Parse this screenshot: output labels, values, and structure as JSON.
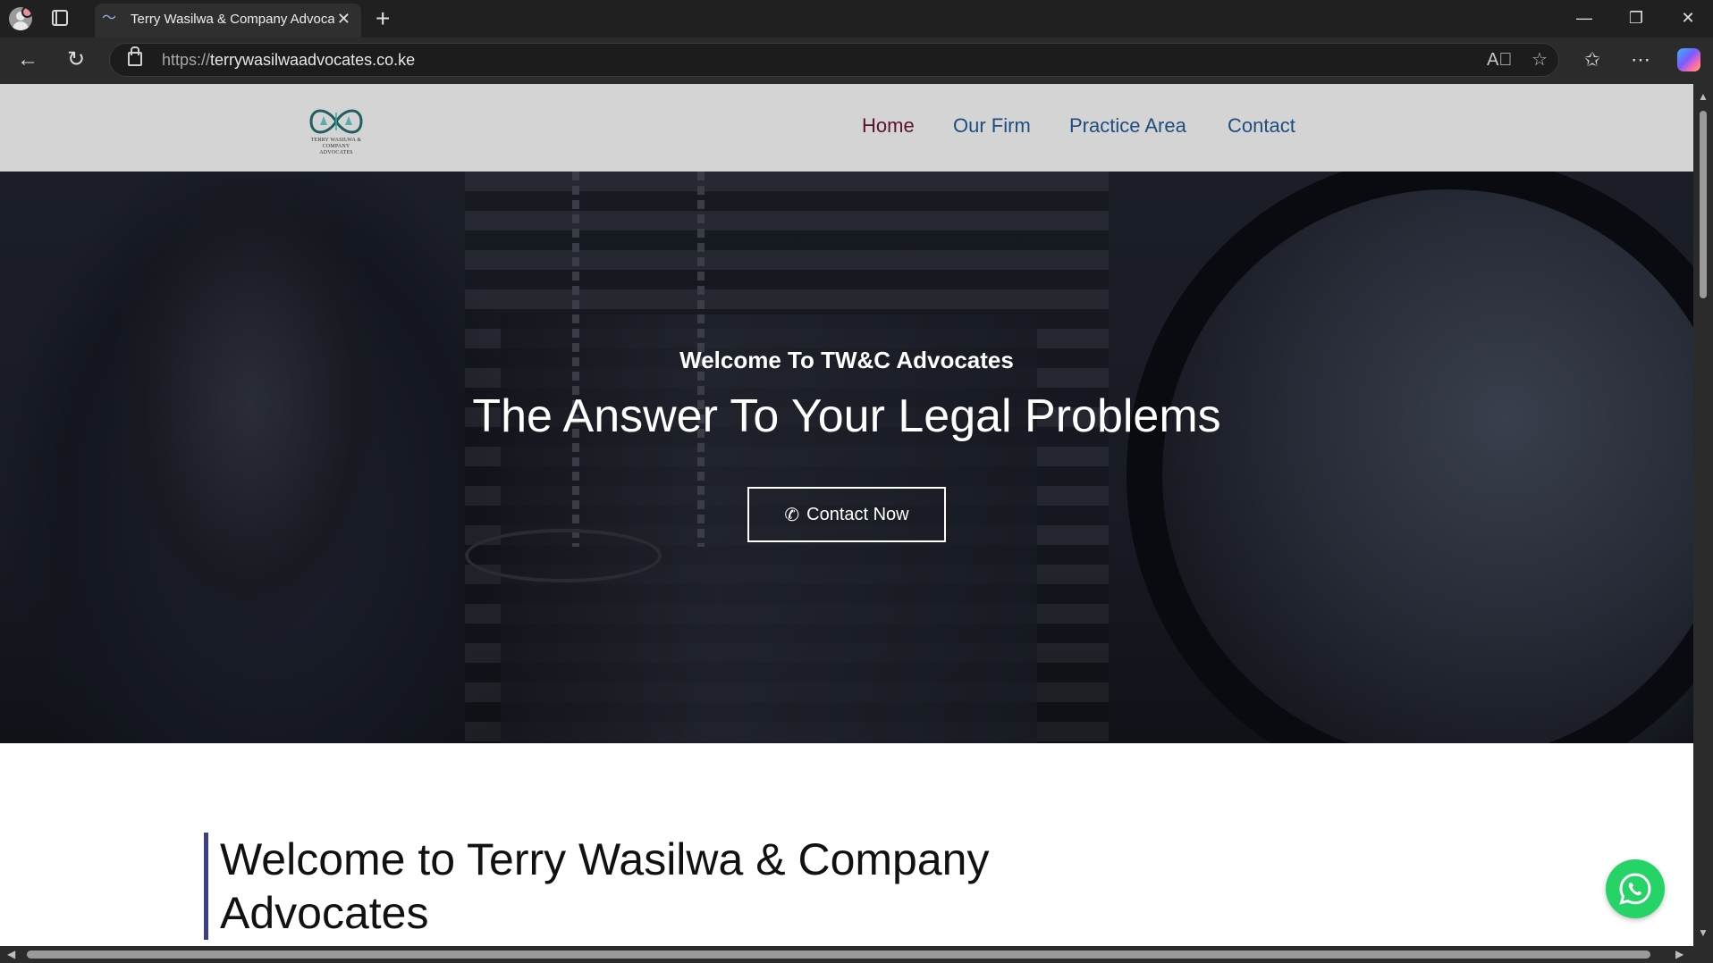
{
  "browser": {
    "tab_title": "Terry Wasilwa & Company Advocates",
    "url_protocol": "https://",
    "url_host": "terrywasilwaadvocates.co.ke",
    "icons": [
      "profile-icon",
      "tab-actions-icon",
      "close-tab-icon",
      "new-tab-icon",
      "minimize-icon",
      "restore-icon",
      "close-window-icon",
      "back-icon",
      "refresh-icon",
      "lock-icon",
      "read-aloud-icon",
      "favorite-star-icon",
      "favorites-icon",
      "more-icon",
      "copilot-icon"
    ]
  },
  "site": {
    "logo": {
      "text_line1": "TERRY WASILWA &",
      "text_line2": "COMPANY",
      "text_line3": "ADVOCATES"
    },
    "nav": [
      {
        "label": "Home",
        "active": true
      },
      {
        "label": "Our Firm",
        "active": false
      },
      {
        "label": "Practice Area",
        "active": false
      },
      {
        "label": "Contact",
        "active": false
      }
    ],
    "hero": {
      "subtitle": "Welcome To TW&C Advocates",
      "title": "The Answer To Your Legal Problems",
      "button_label": "Contact Now"
    },
    "intro": {
      "title": "Welcome to Terry Wasilwa & Company Advocates"
    },
    "colors": {
      "nav_link": "#1f4d80",
      "nav_active": "#5a1230",
      "accent_bar": "#3b3f86",
      "whatsapp": "#25d366"
    }
  }
}
